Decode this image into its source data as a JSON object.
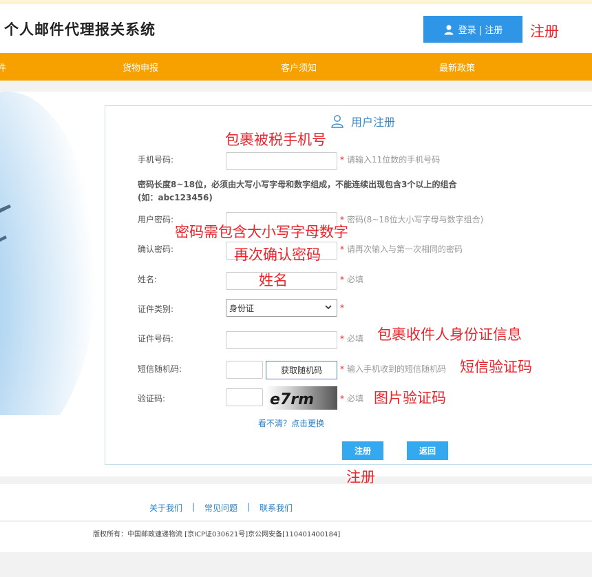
{
  "header": {
    "site_title": "个人邮件代理报关系统",
    "login_label": "登录 | 注册"
  },
  "nav": {
    "items": [
      {
        "label": "件"
      },
      {
        "label": "货物申报"
      },
      {
        "label": "客户须知"
      },
      {
        "label": "最新政策"
      }
    ]
  },
  "form": {
    "title": "用户注册",
    "phone": {
      "label": "手机号码:",
      "hint": "请输入11位数的手机号码"
    },
    "rule_line1": "密码长度8~18位，必须由大写小写字母和数字组成，不能连续出现包含3个以上的组合",
    "rule_line2": "(如：abc123456)",
    "password": {
      "label": "用户密码:",
      "hint": "密码(8~18位大小写字母与数字组合)"
    },
    "confirm": {
      "label": "确认密码:",
      "hint": "请再次输入与第一次相同的密码"
    },
    "name": {
      "label": "姓名:",
      "hint": "必填"
    },
    "id_type": {
      "label": "证件类别:",
      "selected": "身份证"
    },
    "id_number": {
      "label": "证件号码:",
      "hint": "必填"
    },
    "sms": {
      "label": "短信随机码:",
      "button": "获取随机码",
      "hint": "输入手机收到的短信随机码"
    },
    "captcha": {
      "label": "验证码:",
      "text": "e7rm",
      "hint": "必填"
    },
    "refresh_link": "看不清？点击更换",
    "submit": "注册",
    "back": "返回",
    "star": "*"
  },
  "annotations": {
    "register_top": "注册",
    "phone_note": "包裹被税手机号",
    "password_note": "密码需包含大小写字母数字",
    "confirm_note": "再次确认密码",
    "name_note": "姓名",
    "id_note": "包裹收件人身份证信息",
    "sms_note": "短信验证码",
    "captcha_note": "图片验证码",
    "register_bottom": "注册"
  },
  "footer": {
    "links": [
      {
        "label": "关于我们"
      },
      {
        "label": "常见问题"
      },
      {
        "label": "联系我们"
      }
    ],
    "separator": "|",
    "copyright": "版权所有：中国邮政速递物流 [京ICP证030621号]京公网安备[110401400184]"
  },
  "colors": {
    "nav_bg": "#f6a100",
    "login_btn": "#2f95e6",
    "annotation": "#e8262e",
    "primary_btn": "#35a9ef",
    "link": "#2f7fc4"
  },
  "icons": {
    "login": "user-icon",
    "panel_title": "user-outline-icon",
    "select": "chevron-down-icon"
  }
}
